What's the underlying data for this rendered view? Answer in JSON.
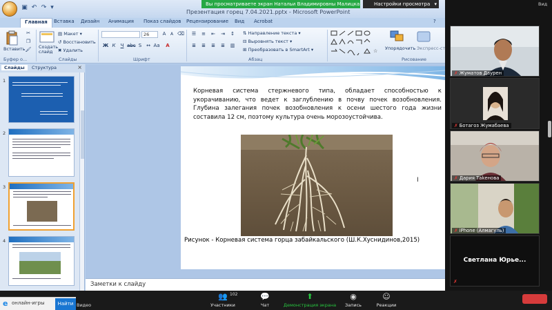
{
  "window": {
    "title": "Презентация горец 7.04.2021.pptx - Microsoft PowerPoint"
  },
  "zoom_banner": {
    "sharing_text": "Вы просматриваете экран Натальи Владимировны Малицкая ...",
    "view_settings": "Настройки просмотра"
  },
  "ribbon": {
    "tabs": [
      "Главная",
      "Вставка",
      "Дизайн",
      "Анимация",
      "Показ слайдов",
      "Рецензирование",
      "Вид",
      "Acrobat"
    ],
    "active_tab": "Главная",
    "groups": {
      "clipboard": {
        "label": "Буфер о...",
        "paste": "Вставить"
      },
      "slides": {
        "label": "Слайды",
        "create": "Создать слайд",
        "layout": "Макет",
        "reset": "Восстановить",
        "delete": "Удалить"
      },
      "font": {
        "label": "Шрифт",
        "font_name": "",
        "font_size": "26"
      },
      "paragraph": {
        "label": "Абзац",
        "text_direction": "Направление текста",
        "align_text": "Выровнять текст",
        "smartart": "Преобразовать в SmartArt"
      },
      "drawing": {
        "label": "Рисование",
        "arrange": "Упорядочить",
        "quick_styles": "Экспресс-сти..."
      }
    }
  },
  "slide_panel": {
    "tabs": [
      "Слайды",
      "Структура"
    ],
    "active_tab": "Слайды",
    "slide_numbers": [
      "1",
      "2",
      "3",
      "4"
    ],
    "selected": 3
  },
  "slide": {
    "body_text": "Корневая система стержневого типа, обладает способностью к укорачиванию, что ведет к заглублению в почву почек возобновления. Глубина залегания почек возобновления к осени шестого года жизни составила 12 см, поэтому культура очень морозоустойчива.",
    "caption": "Рисунок  - Корневая система горца забайкальского (Ш.К.Хуснидинов,2015)"
  },
  "notes": {
    "placeholder": "Заметки к слайду"
  },
  "zoom_toolbar": {
    "participants_label": "Участники",
    "participants_count": "102",
    "chat_label": "Чат",
    "share_label": "Демонстрация экрана",
    "record_label": "Запись",
    "reactions_label": "Реакции",
    "video_label": "Видео"
  },
  "taskbar": {
    "search_text": "онлайн-игры",
    "button_label": "Найти"
  },
  "participants": {
    "top_label": "Вид",
    "tiles": [
      {
        "name": "Жуматов Даурен"
      },
      {
        "name": "Ботагоз Жумабаева"
      },
      {
        "name": "Дария Таkенова"
      },
      {
        "name": "iPhone (Алмагуль)"
      }
    ],
    "name_card": "Светлана  Юрье..."
  },
  "colors": {
    "zoom_green": "#26a844",
    "ribbon_blue": "#1e3a64",
    "selection_orange": "#f0a030",
    "mute_red": "#e53935"
  }
}
